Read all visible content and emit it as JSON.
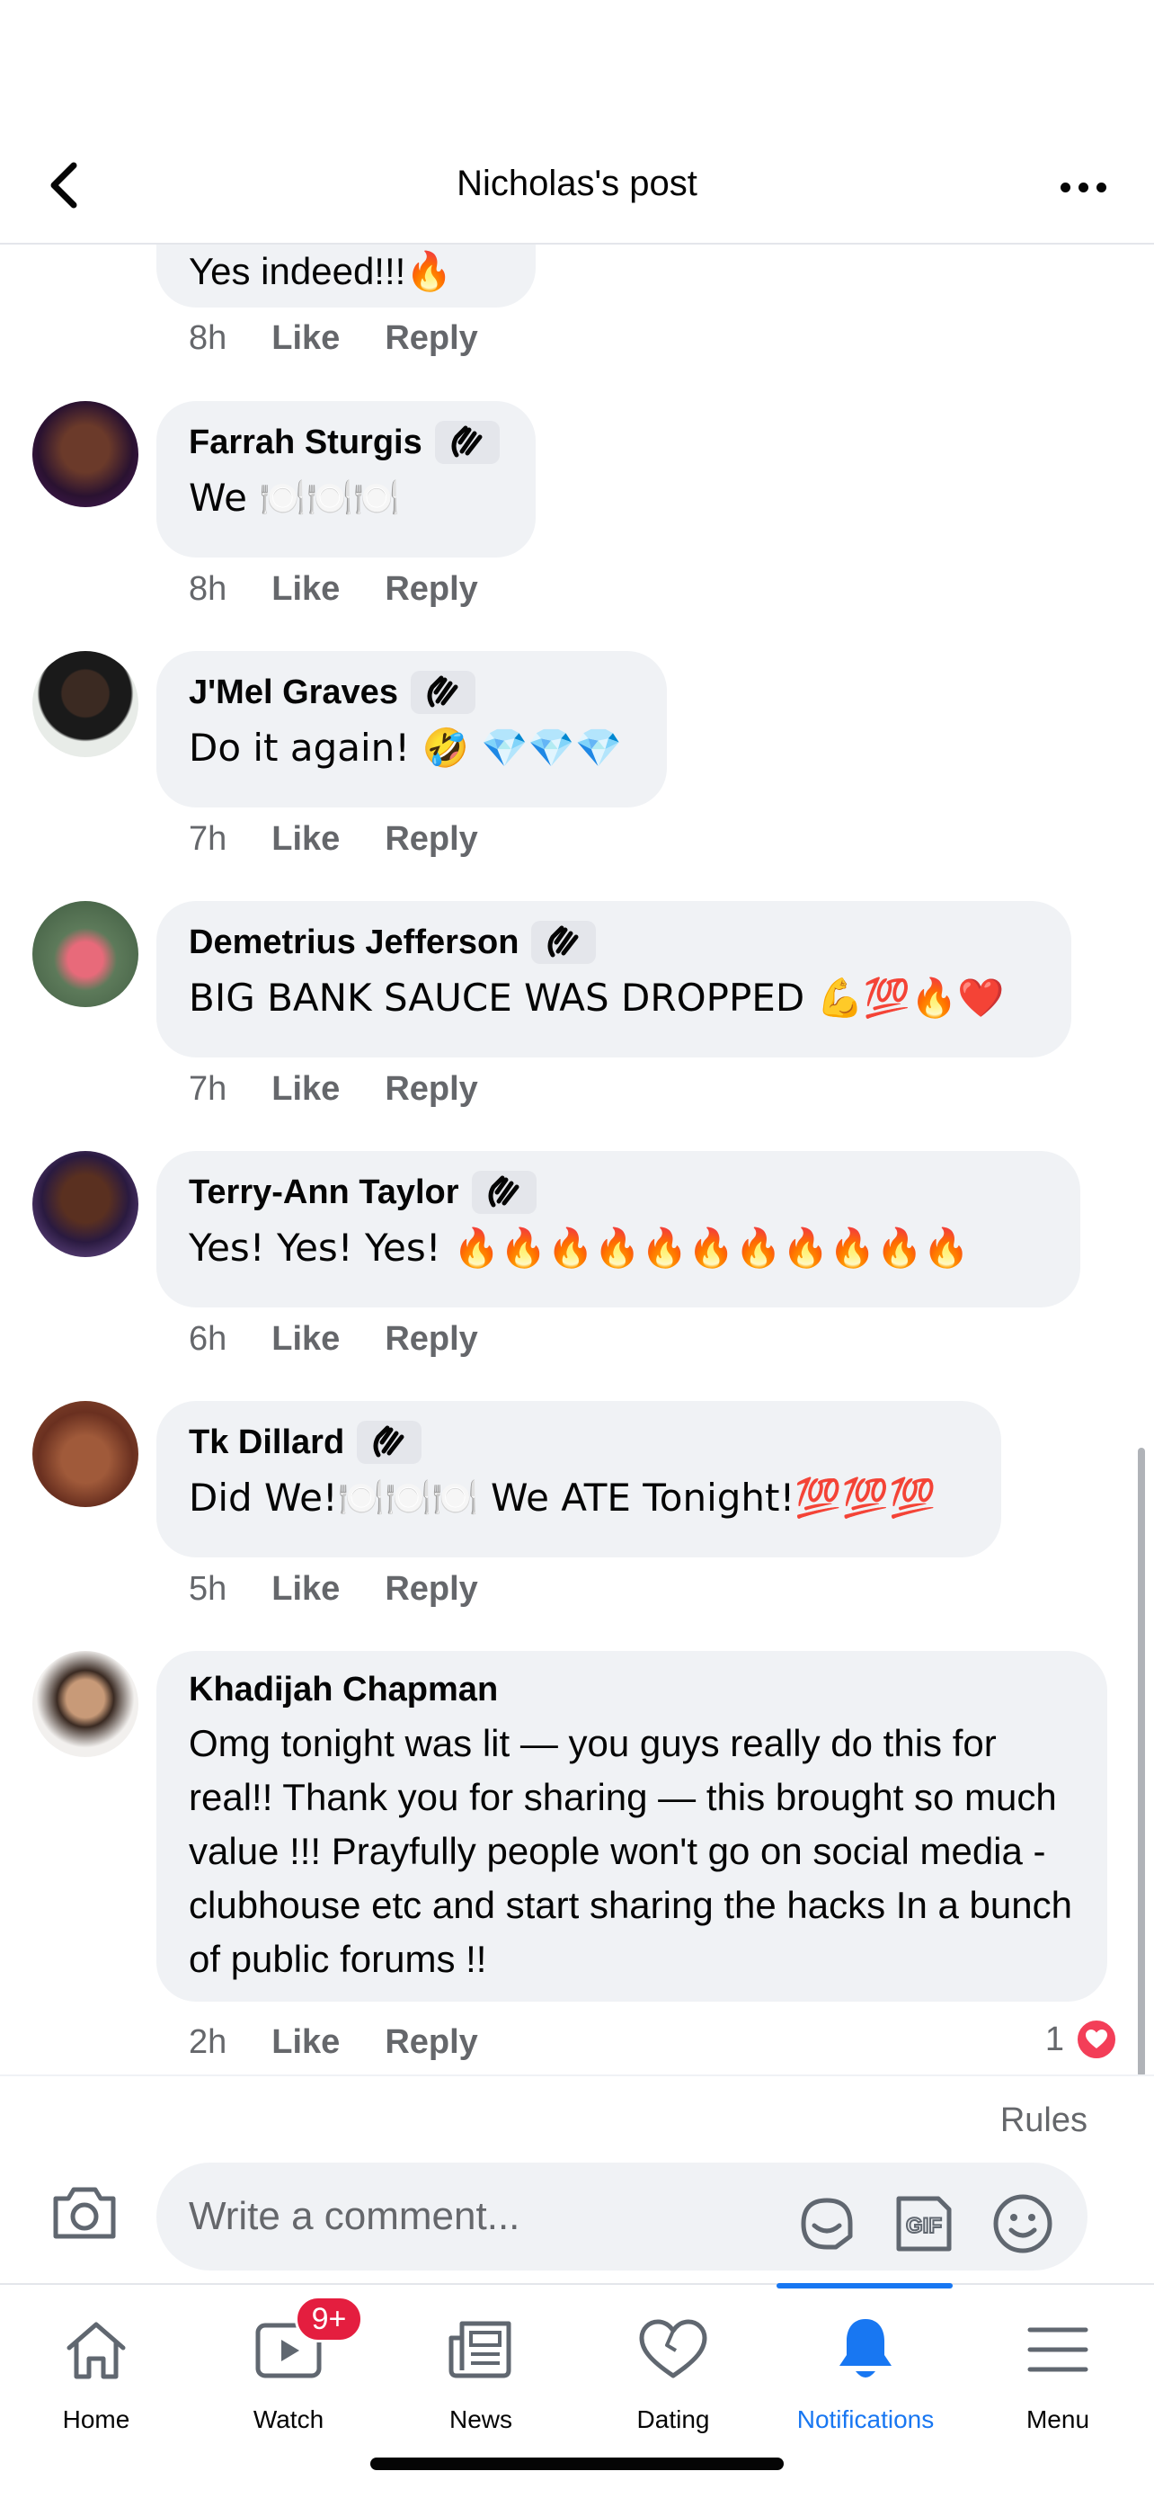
{
  "header": {
    "title": "Nicholas's post"
  },
  "comments": [
    {
      "author": "",
      "text": "Yes indeed!!!🔥",
      "time": "8h",
      "like": "Like",
      "reply": "Reply",
      "badge": false
    },
    {
      "author": "Farrah Sturgis",
      "text": "We 🍽️🍽️🍽️",
      "time": "8h",
      "like": "Like",
      "reply": "Reply",
      "badge": true
    },
    {
      "author": "J'Mel Graves",
      "text": "Do it again! 🤣 💎💎💎",
      "time": "7h",
      "like": "Like",
      "reply": "Reply",
      "badge": true
    },
    {
      "author": "Demetrius Jefferson",
      "text": "BIG BANK SAUCE WAS DROPPED 💪💯🔥❤️",
      "time": "7h",
      "like": "Like",
      "reply": "Reply",
      "badge": true
    },
    {
      "author": "Terry-Ann Taylor",
      "text": "Yes! Yes! Yes! 🔥🔥🔥🔥🔥🔥🔥🔥🔥🔥🔥",
      "time": "6h",
      "like": "Like",
      "reply": "Reply",
      "badge": true
    },
    {
      "author": "Tk Dillard",
      "text": "Did We!🍽️🍽️🍽️ We ATE Tonight!💯💯💯",
      "time": "5h",
      "like": "Like",
      "reply": "Reply",
      "badge": true
    },
    {
      "author": "Khadijah Chapman",
      "text": "Omg tonight was lit — you guys really do this for real!! Thank you for sharing — this brought so much value !!! Prayfully people won't go on social media - clubhouse etc and start sharing the hacks In a bunch of public forums !!",
      "time": "2h",
      "like": "Like",
      "reply": "Reply",
      "badge": false,
      "reaction_count": "1"
    }
  ],
  "composer": {
    "rules": "Rules",
    "placeholder": "Write a comment...",
    "gif_label": "GIF"
  },
  "tabbar": {
    "tabs": [
      {
        "label": "Home",
        "icon": "home-icon"
      },
      {
        "label": "Watch",
        "icon": "watch-icon",
        "badge": "9+"
      },
      {
        "label": "News",
        "icon": "news-icon"
      },
      {
        "label": "Dating",
        "icon": "dating-icon"
      },
      {
        "label": "Notifications",
        "icon": "notifications-icon",
        "active": true
      },
      {
        "label": "Menu",
        "icon": "menu-icon"
      }
    ]
  },
  "colors": {
    "accent": "#1877f2",
    "bubble": "#f0f2f5",
    "secondary_text": "#65676b",
    "badge_red": "#e41e3f",
    "heart": "#f33e58"
  }
}
